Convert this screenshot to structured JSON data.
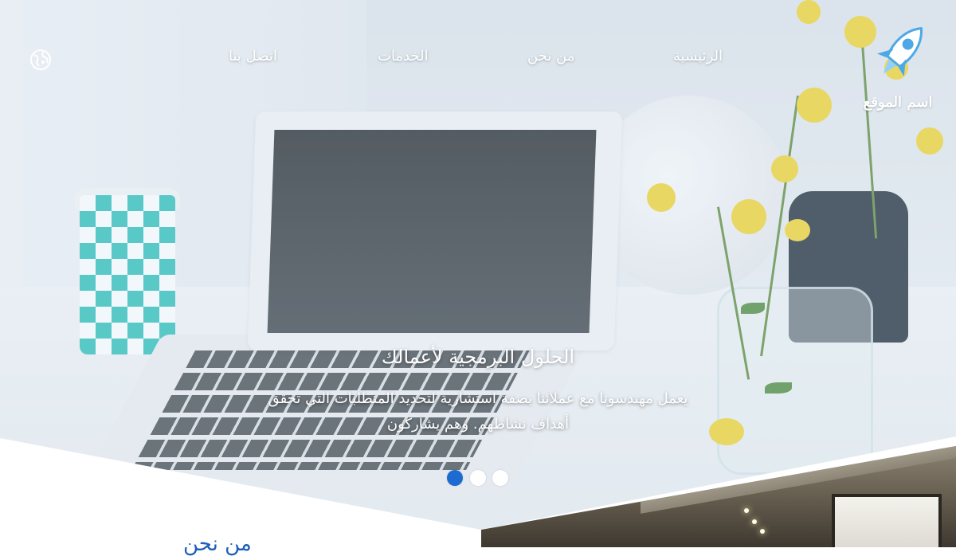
{
  "site": {
    "logo_text": "اسم الموقع"
  },
  "nav": {
    "home": "الرئيسية",
    "about": "من نحن",
    "services": "الخدمات",
    "contact": "اتصل بنا"
  },
  "language_icon": "globe-language-icon",
  "hero": {
    "title": "الحلول البرمجية لأعمالك",
    "description": "يعمل مهندسونا مع عملائنا بصفة استشارية لتحديد المتطلبات التي تحقق أهداف نشاطهم. وهم يشاركون",
    "slides": 3,
    "active_slide": 1
  },
  "about": {
    "title": "من نحن"
  },
  "colors": {
    "accent": "#1d6bd0",
    "heading_blue": "#1f5db8",
    "text_light": "#ffffff"
  }
}
